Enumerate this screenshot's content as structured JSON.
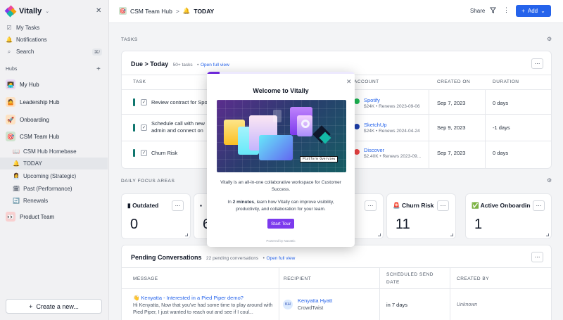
{
  "app": {
    "name": "Vitally"
  },
  "sidebar": {
    "nav": [
      {
        "label": "My Tasks",
        "icon": "check-square-icon"
      },
      {
        "label": "Notifications",
        "icon": "bell-icon"
      },
      {
        "label": "Search",
        "icon": "search-icon",
        "shortcut": "⌘/"
      }
    ],
    "hubs_label": "Hubs",
    "hubs": [
      {
        "label": "My Hub",
        "emoji": "🧑‍💻",
        "color": "#e8d5f5"
      },
      {
        "label": "Leadership Hub",
        "emoji": "🤷",
        "color": "#fde2c3"
      },
      {
        "label": "Onboarding",
        "emoji": "🚀",
        "color": "#fde2c3"
      },
      {
        "label": "CSM Team Hub",
        "emoji": "🎯",
        "color": "#cfe3cf"
      }
    ],
    "subitems": [
      {
        "label": "CSM Hub Homebase",
        "emoji": "📖"
      },
      {
        "label": "TODAY",
        "emoji": "🔔"
      },
      {
        "label": "Upcoming (Strategic)",
        "emoji": "👩‍💼"
      },
      {
        "label": "Past (Performance)",
        "emoji": "🗓"
      },
      {
        "label": "Renewals",
        "emoji": "🔄"
      }
    ],
    "product_hub": {
      "label": "Product Team",
      "emoji": "👀",
      "color": "#f9d0d0"
    },
    "create_label": "Create a new..."
  },
  "topbar": {
    "hub": "CSM Team Hub",
    "sep": ">",
    "current_emoji": "🔔",
    "current": "TODAY",
    "share": "Share",
    "add": "Add"
  },
  "tasks": {
    "section_label": "TASKS",
    "title": "Due > Today",
    "count": "50+ tasks",
    "bullet": "•",
    "link": "Open full view",
    "columns": {
      "task": "TASK",
      "account": "ACCOUNT",
      "created": "CREATED ON",
      "duration": "DURATION"
    },
    "rows": [
      {
        "task": "Review contract for Spotify",
        "account": "Spotify",
        "meta": "$24K • Renews 2023-09-06",
        "created": "Sep 7, 2023",
        "duration": "0 days",
        "logo_color": "#1db954"
      },
      {
        "task": "Schedule call with new admin and connect on Linkedin",
        "account": "SketchUp",
        "meta": "$24K • Renews 2024-04-24",
        "created": "Sep 9, 2023",
        "duration": "-1 days",
        "logo_color": "#1e40af"
      },
      {
        "task": "Churn Risk",
        "account": "Discover",
        "meta": "$2.40K • Renews 2023-09...",
        "created": "Sep 7, 2023",
        "duration": "0 days",
        "logo_color": "#ef4444"
      }
    ]
  },
  "focus": {
    "section_label": "DAILY FOCUS AREAS",
    "cards": [
      {
        "emoji": "▮",
        "title": "Outdated",
        "value": "0"
      },
      {
        "emoji": "▪",
        "title": "",
        "value": "6"
      },
      {
        "emoji": "",
        "title": "",
        "value": ""
      },
      {
        "emoji": "",
        "title": "",
        "value": ""
      },
      {
        "emoji": "🚨",
        "title": "Churn Risk",
        "value": "11"
      },
      {
        "emoji": "✅",
        "title": "Active Onboarding",
        "value": "1"
      }
    ]
  },
  "conversations": {
    "title": "Pending Conversations",
    "count": "22 pending conversations",
    "bullet": "•",
    "link": "Open full view",
    "columns": {
      "message": "MESSAGE",
      "recipient": "RECIPIENT",
      "scheduled_1": "SCHEDULED SEND",
      "scheduled_2": "DATE",
      "created_by": "CREATED BY"
    },
    "rows": [
      {
        "subject": "👋 Kenyatta - Interested in a Pied Piper demo?",
        "body": "Hi Kenyatta, Now that you've had some time to play around with Pied Piper, I just wanted to reach out and see if I coul...",
        "initials": "KH",
        "recipient": "Kenyatta Hyatt",
        "company": "CrowdTwist",
        "scheduled": "in 7 days",
        "created_by": "Unknown"
      }
    ]
  },
  "modal": {
    "title": "Welcome to Vitally",
    "progress": 0.086,
    "image_caption": "Platform Overview",
    "para1": "Vitally is an all-in-one collaborative workspace for Customer Success.",
    "para2_prefix": "In ",
    "para2_bold": "2 minutes",
    "para2_suffix": ", learn how Vitally can improve visibility, productivity, and collaboration for your team.",
    "button": "Start Tour",
    "footer": "Powered by Navattic"
  }
}
